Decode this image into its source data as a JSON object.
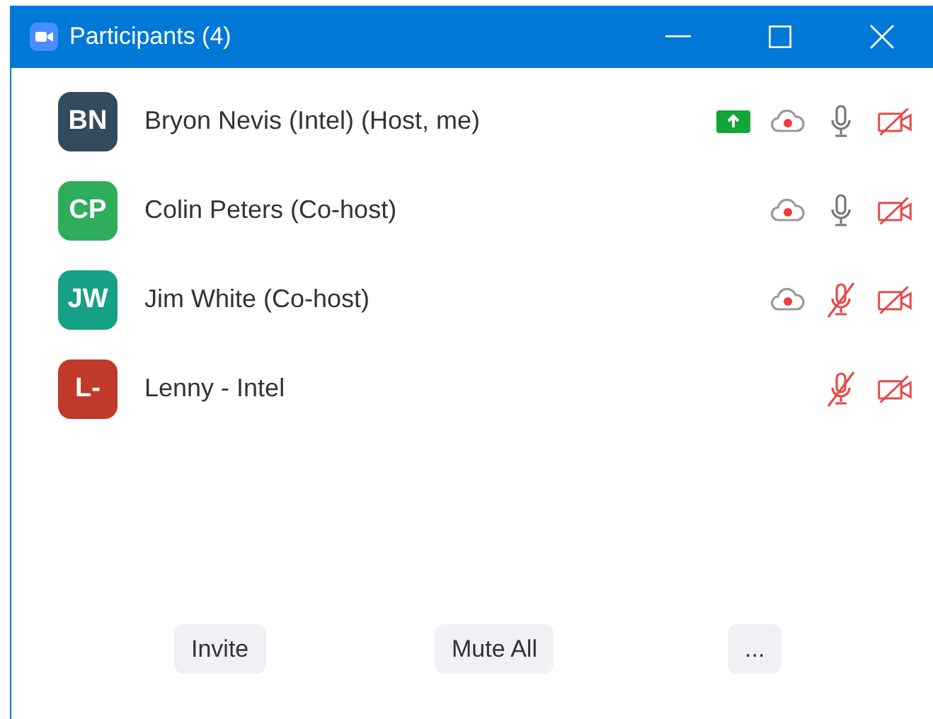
{
  "window": {
    "title": "Participants (4)"
  },
  "participants": [
    {
      "initials": "BN",
      "color": "#344a5e",
      "name": "Bryon Nevis (Intel) (Host, me)",
      "sharing": true,
      "recording": true,
      "muted": false,
      "video_on": false
    },
    {
      "initials": "CP",
      "color": "#2ead5c",
      "name": "Colin Peters (Co-host)",
      "sharing": false,
      "recording": true,
      "muted": false,
      "video_on": false
    },
    {
      "initials": "JW",
      "color": "#16a085",
      "name": "Jim White (Co-host)",
      "sharing": false,
      "recording": true,
      "muted": true,
      "video_on": false
    },
    {
      "initials": "L-",
      "color": "#c0392b",
      "name": "Lenny - Intel",
      "sharing": false,
      "recording": false,
      "muted": true,
      "video_on": false
    }
  ],
  "buttons": [
    "Invite",
    "Mute All",
    "..."
  ]
}
